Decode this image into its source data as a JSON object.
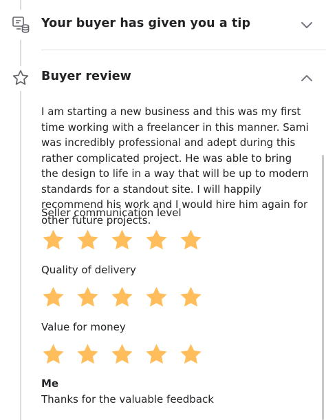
{
  "tip_section": {
    "title": "Your buyer has given you a tip",
    "icon": "tip-coins-icon",
    "expanded": false
  },
  "review_section": {
    "title": "Buyer review",
    "icon": "star-outline-icon",
    "expanded": true,
    "review_text": "I am starting a new business and this was my first time working with a freelancer in this manner. Sami was incredibly professional and adept during this rather complicated project. He was able to bring the design to life in a way that will be up to modern standards for a standout site. I will happily recommend his work and I would hire him again for other future projects.",
    "ratings": [
      {
        "label": "Seller communication level",
        "stars": 5,
        "max": 5
      },
      {
        "label": "Quality of delivery",
        "stars": 5,
        "max": 5
      },
      {
        "label": "Value for money",
        "stars": 5,
        "max": 5
      }
    ],
    "reply": {
      "author": "Me",
      "text": "Thanks for the valuable feedback"
    }
  },
  "colors": {
    "star_fill": "#FFBE5B",
    "timeline": "#DADBDD",
    "text": "#222325"
  }
}
